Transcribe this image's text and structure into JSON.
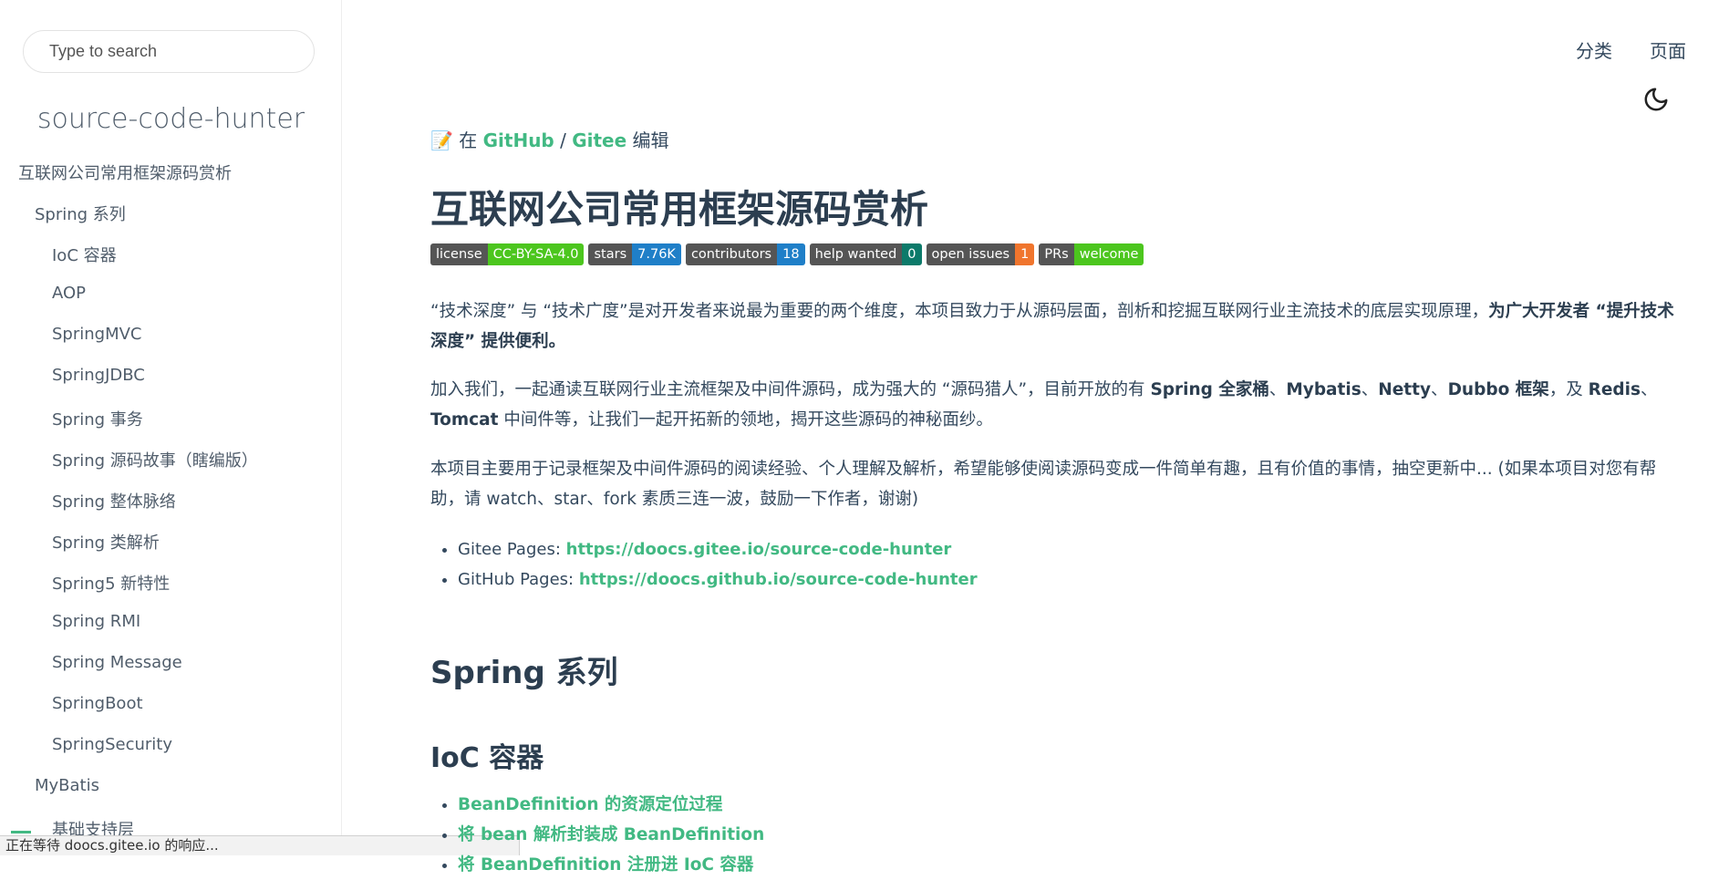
{
  "sidebar": {
    "search_placeholder": "Type to search",
    "app_name": "source-code-hunter",
    "items": [
      {
        "label": "互联网公司常用框架源码赏析"
      },
      {
        "label": "Spring 系列"
      },
      {
        "label": "IoC 容器"
      },
      {
        "label": "AOP"
      },
      {
        "label": "SpringMVC"
      },
      {
        "label": "SpringJDBC"
      },
      {
        "label": "Spring 事务"
      },
      {
        "label": "Spring 源码故事（瞎编版）"
      },
      {
        "label": "Spring 整体脉络"
      },
      {
        "label": "Spring 类解析"
      },
      {
        "label": "Spring5 新特性"
      },
      {
        "label": "Spring RMI"
      },
      {
        "label": "Spring Message"
      },
      {
        "label": "SpringBoot"
      },
      {
        "label": "SpringSecurity"
      },
      {
        "label": "MyBatis"
      },
      {
        "label": "基础支持层"
      }
    ]
  },
  "status_bar": "正在等待 doocs.gitee.io 的响应...",
  "topnav": {
    "categories": "分类",
    "pages": "页面"
  },
  "content": {
    "edit_prefix": "📝 在 ",
    "github": "GitHub",
    "sep": " / ",
    "gitee": "Gitee",
    "edit_suffix": " 编辑",
    "title": "互联网公司常用框架源码赏析",
    "badges": [
      {
        "key": "license",
        "value": "CC-BY-SA-4.0",
        "color": "#4cc61e"
      },
      {
        "key": "stars",
        "value": "7.76K",
        "color": "#1f7fc8"
      },
      {
        "key": "contributors",
        "value": "18",
        "color": "#1f7fc8"
      },
      {
        "key": "help wanted",
        "value": "0",
        "color": "#0c7a6a"
      },
      {
        "key": "open issues",
        "value": "1",
        "color": "#f0752d"
      },
      {
        "key": "PRs",
        "value": "welcome",
        "color": "#4cc61e"
      }
    ],
    "p1_text": "“技术深度” 与 “技术广度”是对开发者来说最为重要的两个维度，本项目致力于从源码层面，剖析和挖掘互联网行业主流技术的底层实现原理，",
    "p1_bold": "为广大开发者 “提升技术深度” 提供便利。",
    "p2_a": "加入我们，一起通读互联网行业主流框架及中间件源码，成为强大的 “源码猎人”，目前开放的有 ",
    "p2_b1": "Spring 全家桶",
    "p2_c": "、",
    "p2_b2": "Mybatis",
    "p2_b3": "Netty",
    "p2_b4": "Dubbo 框架",
    "p2_d": "，及 ",
    "p2_b5": "Redis",
    "p2_b6": "Tomcat",
    "p2_e": " 中间件等，让我们一起开拓新的领地，揭开这些源码的神秘面纱。",
    "p3": "本项目主要用于记录框架及中间件源码的阅读经验、个人理解及解析，希望能够使阅读源码变成一件简单有趣，且有价值的事情，抽空更新中... (如果本项目对您有帮助，请 watch、star、fork 素质三连一波，鼓励一下作者，谢谢)",
    "links": [
      {
        "label": "Gitee Pages: ",
        "url": "https://doocs.gitee.io/source-code-hunter"
      },
      {
        "label": "GitHub Pages: ",
        "url": "https://doocs.github.io/source-code-hunter"
      }
    ],
    "section_title": "Spring 系列",
    "sub_title": "IoC 容器",
    "ioc_items": [
      "BeanDefinition 的资源定位过程",
      "将 bean 解析封装成 BeanDefinition",
      "将 BeanDefinition 注册进 IoC 容器"
    ]
  }
}
